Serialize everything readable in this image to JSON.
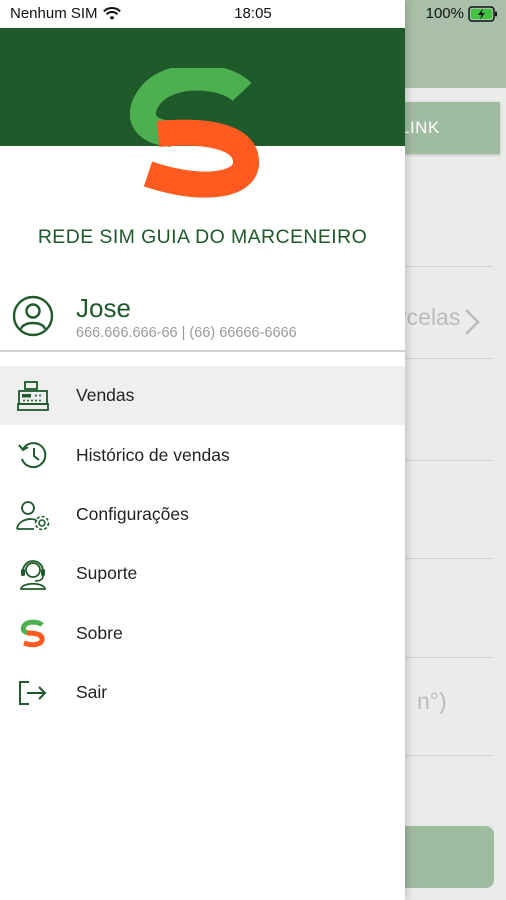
{
  "status_bar": {
    "carrier": "Nenhum SIM",
    "time": "18:05",
    "battery": "100%"
  },
  "background_screen": {
    "link_button_label": "LINK",
    "parcelas_text": "rcelas",
    "numero_text": "n°)"
  },
  "drawer": {
    "brand_title": "REDE SIM GUIA DO MARCENEIRO",
    "user": {
      "name": "Jose",
      "info": "666.666.666-66 | (66) 66666-6666"
    },
    "menu": [
      {
        "label": "Vendas",
        "icon": "cash-register-icon",
        "active": true
      },
      {
        "label": "Histórico de vendas",
        "icon": "history-icon",
        "active": false
      },
      {
        "label": "Configurações",
        "icon": "user-settings-icon",
        "active": false
      },
      {
        "label": "Suporte",
        "icon": "support-headset-icon",
        "active": false
      },
      {
        "label": "Sobre",
        "icon": "brand-logo-icon",
        "active": false
      },
      {
        "label": "Sair",
        "icon": "logout-icon",
        "active": false
      }
    ]
  },
  "colors": {
    "brand_dark_green": "#1e5a2a",
    "logo_green": "#4caf50",
    "logo_orange": "#ff5a1f",
    "bg_header_green": "#a9bfa9"
  }
}
